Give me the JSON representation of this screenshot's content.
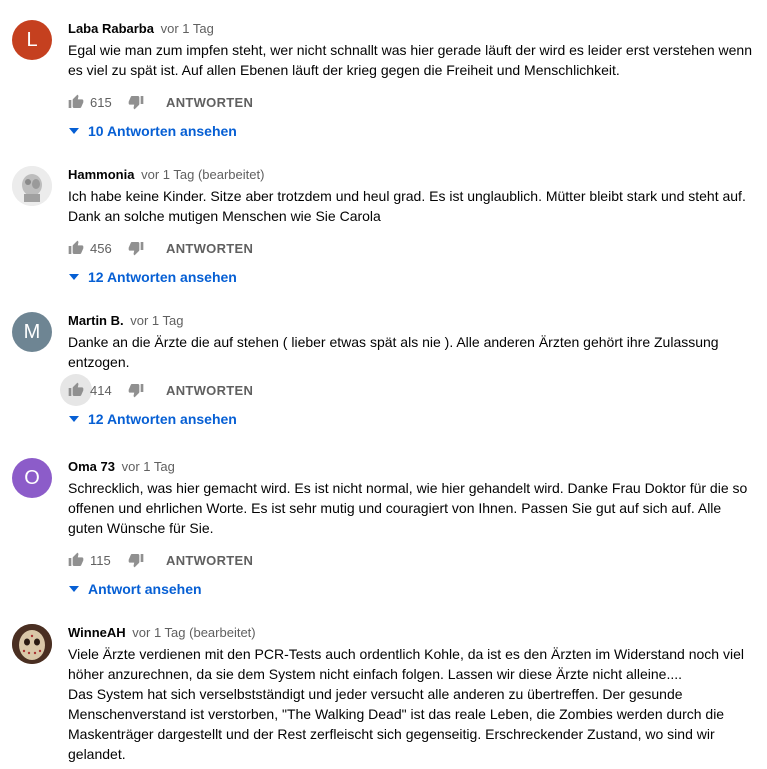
{
  "action_labels": {
    "reply": "ANTWORTEN"
  },
  "comments": [
    {
      "avatar_letter": "L",
      "avatar_color": "#c5401f",
      "author": "Laba Rabarba",
      "time": "vor 1 Tag",
      "text_lines": [
        "Egal wie man zum impfen steht, wer nicht schnallt was hier gerade läuft der wird es leider erst verstehen wenn es viel zu spät ist. Auf allen Ebenen läuft der krieg gegen die Freiheit und Menschlichkeit."
      ],
      "likes": "615",
      "replies": "10 Antworten ansehen"
    },
    {
      "avatar_letter": "",
      "avatar_color": "#e6e6e6",
      "author": "Hammonia",
      "time": "vor 1 Tag (bearbeitet)",
      "text_lines": [
        "Ich habe keine Kinder. Sitze aber trotzdem und heul grad. Es ist unglaublich. Mütter bleibt stark und steht auf. Dank an solche mutigen Menschen wie Sie Carola"
      ],
      "likes": "456",
      "replies": "12 Antworten ansehen"
    },
    {
      "avatar_letter": "M",
      "avatar_color": "#6e8593",
      "author": "Martin B.",
      "time": "vor 1 Tag",
      "text_lines": [
        "Danke an die Ärzte die auf stehen ( lieber etwas spät als nie ). Alle anderen Ärzten gehört ihre Zulassung entzogen."
      ],
      "likes": "414",
      "replies": "12 Antworten ansehen"
    },
    {
      "avatar_letter": "O",
      "avatar_color": "#8c5cc9",
      "author": "Oma 73",
      "time": "vor 1 Tag",
      "text_lines": [
        "Schrecklich, was hier gemacht wird. Es ist nicht normal, wie hier gehandelt wird. Danke Frau Doktor für die so offenen und ehrlichen Worte. Es ist sehr mutig und couragiert von Ihnen. Passen Sie gut auf sich auf. Alle guten Wünsche für Sie."
      ],
      "likes": "115",
      "replies": "Antwort ansehen"
    },
    {
      "avatar_letter": "",
      "avatar_color": "#5a3b2a",
      "author": "WinneAH",
      "time": "vor 1 Tag (bearbeitet)",
      "text_lines": [
        "Viele Ärzte verdienen mit den PCR-Tests auch ordentlich Kohle, da ist es den Ärzten im Widerstand noch viel höher anzurechnen, da sie dem System nicht einfach folgen. Lassen wir diese Ärzte nicht alleine....",
        "Das System hat sich verselbstständigt und jeder versucht alle anderen zu übertreffen. Der gesunde Menschenverstand ist verstorben, \"The Walking Dead\" ist das reale Leben, die Zombies werden durch die Maskenträger dargestellt und der Rest zerfleischt sich gegenseitig. Erschreckender Zustand, wo sind wir gelandet."
      ]
    }
  ],
  "colors": {
    "link": "#065fd4",
    "secondary_text": "#606060"
  },
  "icons": {
    "like": "thumb-up-icon",
    "dislike": "thumb-down-icon",
    "expand": "caret-down-icon"
  }
}
